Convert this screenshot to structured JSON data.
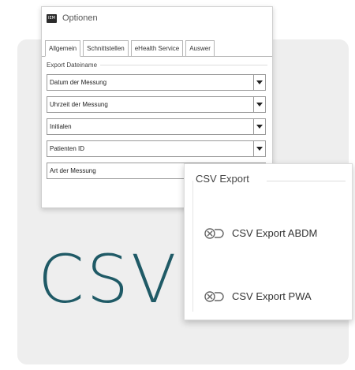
{
  "window": {
    "icon_label": "IEM",
    "title": "Optionen"
  },
  "tabs": [
    {
      "label": "Allgemein"
    },
    {
      "label": "Schnittstellen"
    },
    {
      "label": "eHealth Service"
    },
    {
      "label": "Auswer"
    }
  ],
  "export_group": {
    "label": "Export Dateiname",
    "fields": [
      {
        "value": "Datum der Messung"
      },
      {
        "value": "Uhrzeit der Messung"
      },
      {
        "value": "Initialen"
      },
      {
        "value": "Patienten ID"
      },
      {
        "value": "Art der Messung"
      }
    ]
  },
  "csv_panel": {
    "title": "CSV Export",
    "buttons": [
      {
        "label": "CSV Export ABDM"
      },
      {
        "label": "CSV Export PWA"
      }
    ]
  },
  "big_label": "CSV",
  "colors": {
    "accent": "#1f5a66",
    "card_background": "#eeeeee"
  }
}
